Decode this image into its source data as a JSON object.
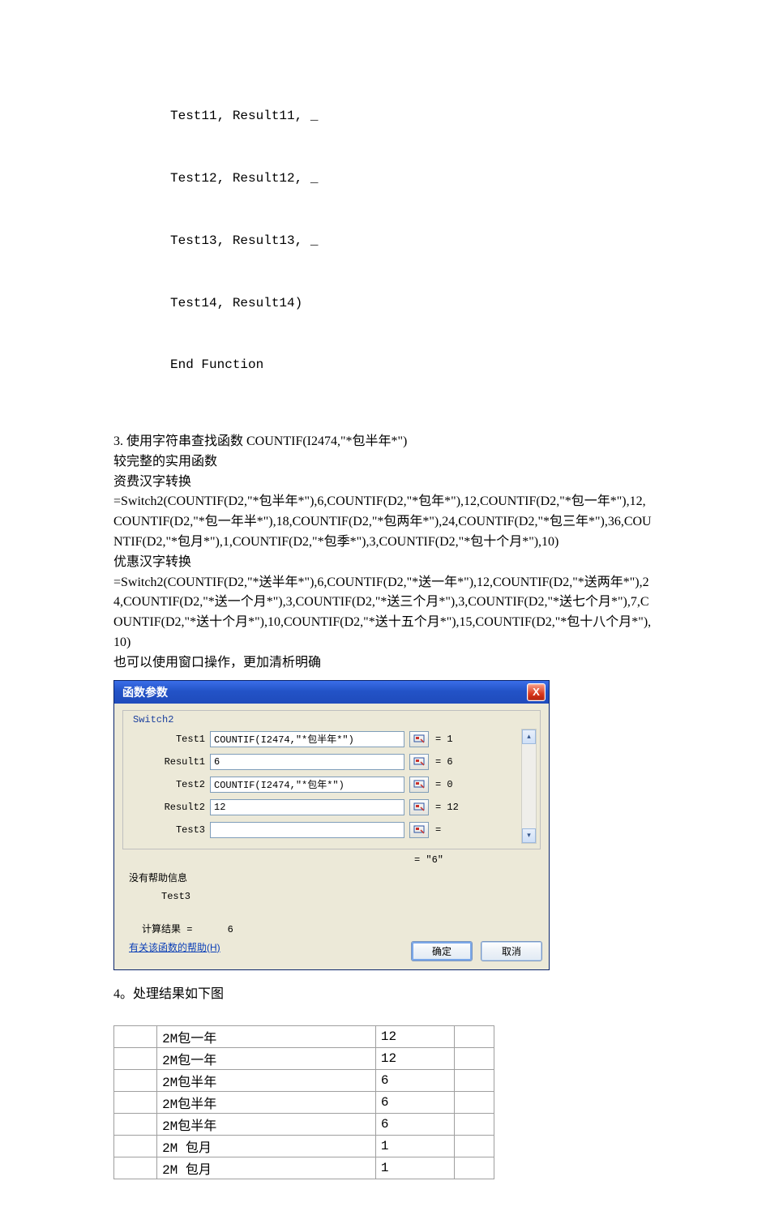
{
  "code_lines": [
    "Test11, Result11, _",
    "Test12, Result12, _",
    "Test13, Result13, _",
    "Test14, Result14)",
    "End Function"
  ],
  "section3": {
    "title": "3. 使用字符串查找函数 COUNTIF(I2474,\"*包半年*\")",
    "line2": "较完整的实用函数",
    "line3": "资费汉字转换",
    "formula1": "=Switch2(COUNTIF(D2,\"*包半年*\"),6,COUNTIF(D2,\"*包年*\"),12,COUNTIF(D2,\"*包一年*\"),12,COUNTIF(D2,\"*包一年半*\"),18,COUNTIF(D2,\"*包两年*\"),24,COUNTIF(D2,\"*包三年*\"),36,COUNTIF(D2,\"*包月*\"),1,COUNTIF(D2,\"*包季*\"),3,COUNTIF(D2,\"*包十个月*\"),10)",
    "line5": "优惠汉字转换",
    "formula2": "=Switch2(COUNTIF(D2,\"*送半年*\"),6,COUNTIF(D2,\"*送一年*\"),12,COUNTIF(D2,\"*送两年*\"),24,COUNTIF(D2,\"*送一个月*\"),3,COUNTIF(D2,\"*送三个月*\"),3,COUNTIF(D2,\"*送七个月*\"),7,COUNTIF(D2,\"*送十个月*\"),10,COUNTIF(D2,\"*送十五个月*\"),15,COUNTIF(D2,\"*包十八个月*\"),10)",
    "line7": "也可以使用窗口操作，更加清析明确"
  },
  "dialog": {
    "title": "函数参数",
    "func_name": "Switch2",
    "params": [
      {
        "label": "Test1",
        "value": "COUNTIF(I2474,\"*包半年*\")",
        "eq": "= 1"
      },
      {
        "label": "Result1",
        "value": "6",
        "eq": "= 6"
      },
      {
        "label": "Test2",
        "value": "COUNTIF(I2474,\"*包年*\")",
        "eq": "= 0"
      },
      {
        "label": "Result2",
        "value": "12",
        "eq": "= 12"
      },
      {
        "label": "Test3",
        "value": "",
        "eq": "="
      }
    ],
    "overall_eq": "= \"6\"",
    "no_help": "没有帮助信息",
    "test3_label": "Test3",
    "calc_label": "计算结果 =",
    "calc_value": "6",
    "help_link": "有关该函数的帮助(H)",
    "ok": "确定",
    "cancel": "取消",
    "scroll_up": "▴",
    "scroll_down": "▾",
    "close": "X"
  },
  "section4": {
    "title": "4。处理结果如下图",
    "rows": [
      {
        "name": "2M包一年",
        "val": "12"
      },
      {
        "name": "2M包一年",
        "val": "12"
      },
      {
        "name": "2M包半年",
        "val": "6"
      },
      {
        "name": "2M包半年",
        "val": "6"
      },
      {
        "name": "2M包半年",
        "val": "6"
      },
      {
        "name": "2M 包月",
        "val": "1"
      },
      {
        "name": "2M 包月",
        "val": "1"
      }
    ]
  }
}
